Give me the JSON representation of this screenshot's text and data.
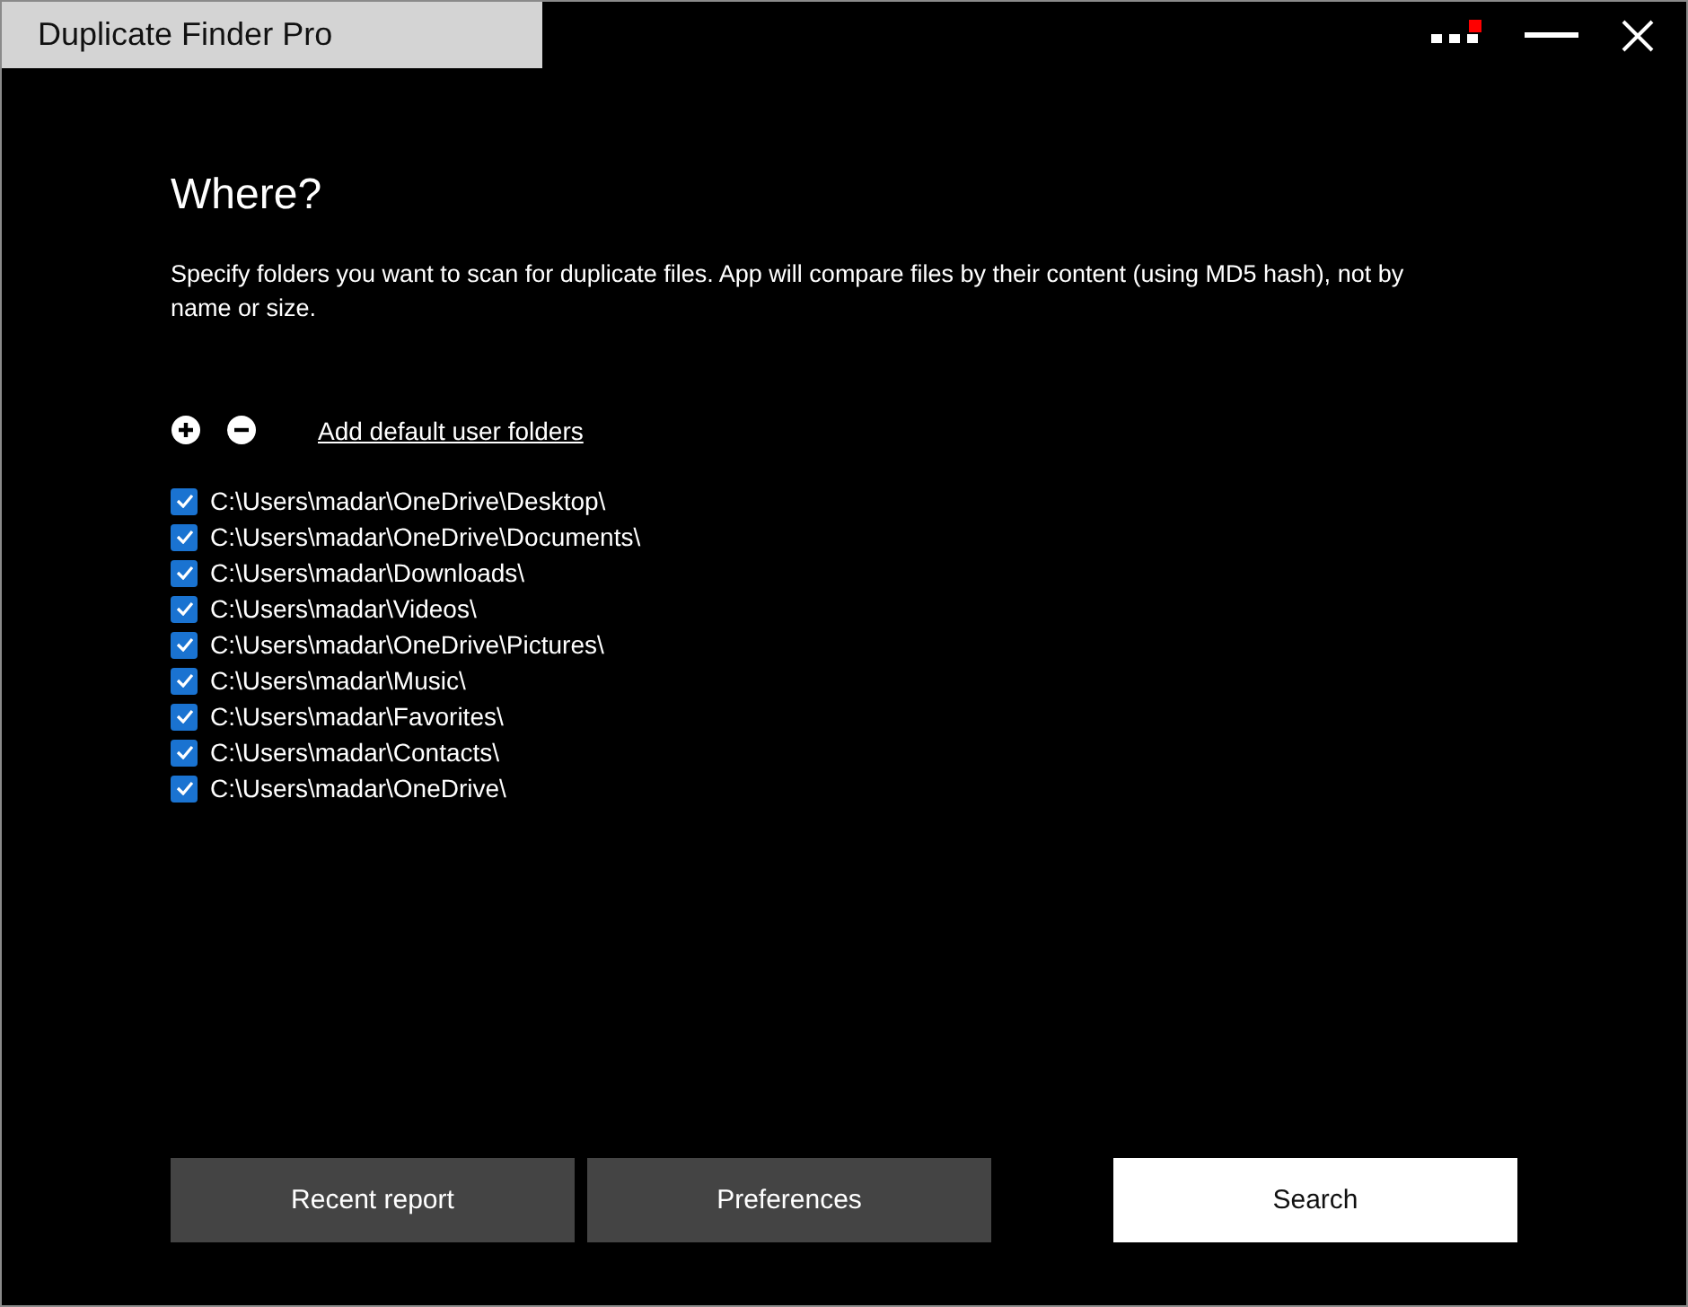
{
  "window": {
    "title": "Duplicate Finder Pro"
  },
  "heading": "Where?",
  "description": "Specify folders you want to scan for duplicate files. App will compare files by their content (using MD5 hash), not by name or size.",
  "add_default_link": "Add default user folders",
  "folders": [
    {
      "path": "C:\\Users\\madar\\OneDrive\\Desktop\\",
      "checked": true
    },
    {
      "path": "C:\\Users\\madar\\OneDrive\\Documents\\",
      "checked": true
    },
    {
      "path": "C:\\Users\\madar\\Downloads\\",
      "checked": true
    },
    {
      "path": "C:\\Users\\madar\\Videos\\",
      "checked": true
    },
    {
      "path": "C:\\Users\\madar\\OneDrive\\Pictures\\",
      "checked": true
    },
    {
      "path": "C:\\Users\\madar\\Music\\",
      "checked": true
    },
    {
      "path": "C:\\Users\\madar\\Favorites\\",
      "checked": true
    },
    {
      "path": "C:\\Users\\madar\\Contacts\\",
      "checked": true
    },
    {
      "path": "C:\\Users\\madar\\OneDrive\\",
      "checked": true
    }
  ],
  "buttons": [
    {
      "label": "Recent report",
      "kind": "secondary"
    },
    {
      "label": "Preferences",
      "kind": "secondary"
    },
    {
      "label": "Search",
      "kind": "primary"
    }
  ]
}
